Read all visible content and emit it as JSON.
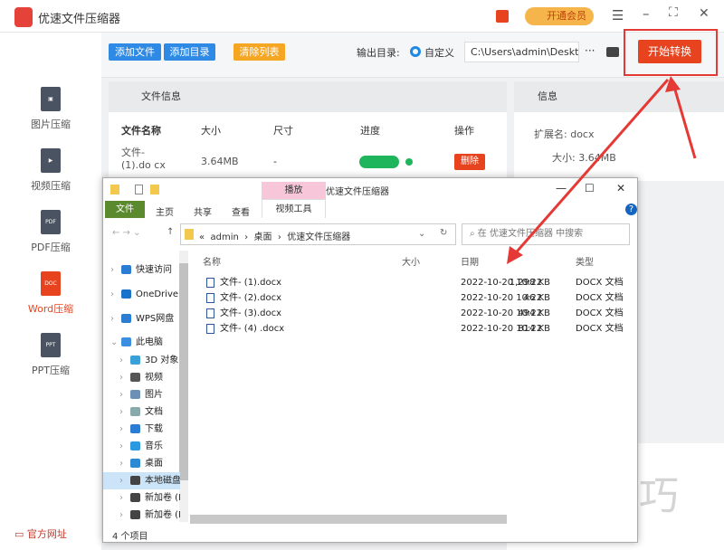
{
  "app": {
    "title": "优速文件压缩器",
    "vip": "开通会员",
    "colors": {
      "accent": "#1e88e5",
      "danger": "#e8431f",
      "orange": "#f5a623"
    }
  },
  "toolbar": {
    "add_file": "添加文件",
    "add_dir": "添加目录",
    "clear": "清除列表",
    "output_label": "输出目录:",
    "radio_custom": "自定义",
    "output_path": "C:\\Users\\admin\\Deskto",
    "more": "···",
    "start": "开始转换"
  },
  "sidebar": {
    "items": [
      {
        "label": "图片压缩",
        "icon": "image-file-icon"
      },
      {
        "label": "视频压缩",
        "icon": "video-file-icon"
      },
      {
        "label": "PDF压缩",
        "icon": "pdf-file-icon",
        "tag": "PDF"
      },
      {
        "label": "Word压缩",
        "icon": "word-file-icon",
        "tag": "DOC"
      },
      {
        "label": "PPT压缩",
        "icon": "ppt-file-icon",
        "tag": "PPT"
      }
    ],
    "footer": "官方网址"
  },
  "file_panel": {
    "title": "文件信息",
    "columns": [
      "文件名称",
      "大小",
      "尺寸",
      "进度",
      "操作"
    ],
    "rows": [
      {
        "name": "文件- (1).do cx",
        "size": "3.64MB",
        "dim": "-",
        "progress": 100,
        "action": "删除"
      }
    ]
  },
  "info_panel": {
    "title": "信息",
    "ext_label": "扩展名:",
    "ext": "docx",
    "size_label": "大小:",
    "size": "3.64MB"
  },
  "explorer": {
    "title": "优速文件压缩器",
    "context_tab": "播放",
    "tabs": [
      "文件",
      "主页",
      "共享",
      "查看",
      "视频工具"
    ],
    "path": [
      "admin",
      "桌面",
      "优速文件压缩器"
    ],
    "search_placeholder": "在 优速文件压缩器 中搜索",
    "columns": [
      "名称",
      "大小",
      "日期",
      "类型"
    ],
    "files": [
      {
        "name": "文件- (1).docx",
        "size": "1,298 KB",
        "date": "2022-10-20 10:22",
        "type": "DOCX 文档"
      },
      {
        "name": "文件- (2).docx",
        "size": "46 KB",
        "date": "2022-10-20 10:22",
        "type": "DOCX 文档"
      },
      {
        "name": "文件- (3).docx",
        "size": "494 KB",
        "date": "2022-10-20 10:22",
        "type": "DOCX 文档"
      },
      {
        "name": "文件- (4) .docx",
        "size": "814 KB",
        "date": "2022-10-20 10:22",
        "type": "DOCX 文档"
      }
    ],
    "nav": [
      {
        "label": "快速访问",
        "color": "#2b7cd3"
      },
      {
        "label": "OneDrive",
        "color": "#1a73c8"
      },
      {
        "label": "WPS网盘",
        "color": "#2b7cd3"
      },
      {
        "label": "此电脑",
        "color": "#3c8ee0"
      },
      {
        "label": "3D 对象",
        "color": "#3aa0d8"
      },
      {
        "label": "视频",
        "color": "#555"
      },
      {
        "label": "图片",
        "color": "#6b8fb5"
      },
      {
        "label": "文档",
        "color": "#8aa"
      },
      {
        "label": "下载",
        "color": "#2b7cd3"
      },
      {
        "label": "音乐",
        "color": "#2b9ae0"
      },
      {
        "label": "桌面",
        "color": "#2b8ad3"
      },
      {
        "label": "本地磁盘",
        "color": "#444"
      },
      {
        "label": "新加卷 (E",
        "color": "#444"
      },
      {
        "label": "新加卷 (F",
        "color": "#444"
      }
    ],
    "status": "4 个项目"
  },
  "watermark": "软件技巧"
}
